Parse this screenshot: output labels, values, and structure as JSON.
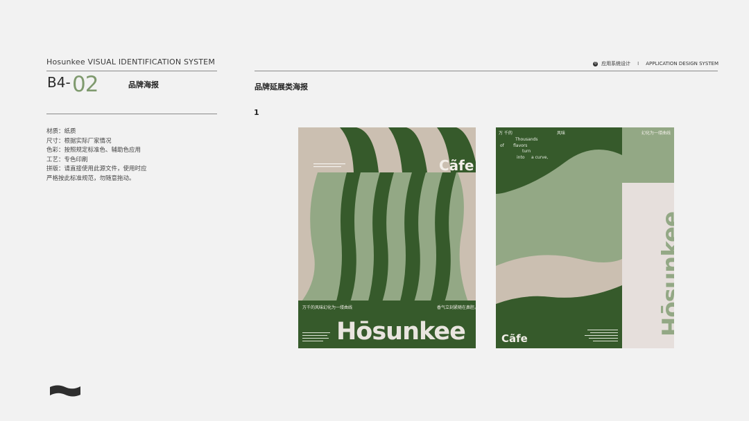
{
  "header": {
    "brand_line": "Hosunkee VISUAL IDENTIFICATION SYSTEM",
    "code_prefix": "B4-",
    "code_number": "02",
    "section_title": "品牌海报",
    "nav_number": "0",
    "nav_cn": "应用系统设计",
    "nav_divider": "I",
    "nav_en": "APPLICATION DESIGN SYSTEM"
  },
  "specs": [
    "材质：纸质",
    "尺寸：根据实际厂家情况",
    "色彩：按照规定标准色、辅助色应用",
    "工艺：专色印刷",
    "拼版：请直接使用此源文件，使用时应",
    "严格按此标准规范，勿随意拖动。"
  ],
  "main": {
    "subtitle": "品牌延展类海报",
    "item_number": "1"
  },
  "poster_left": {
    "cafe": "Cãfe",
    "brand": "Hōsunkee",
    "tagline_cn": "万千的风味幻化为一缕曲线",
    "tagline_right": "香气立刻紧随在鼻腔。"
  },
  "poster_right": {
    "cn_left": "万  千的",
    "cn_mid": "风味",
    "en_lines": [
      "Thousands",
      "of       flavors",
      "turn",
      "into     a curve,"
    ],
    "cafe": "Cãfe",
    "brand": "Hōsunkee",
    "corner_cn": "幻化为一缕曲线"
  },
  "colors": {
    "background": "#f2f2f2",
    "dark_green": "#365a2b",
    "sage": "#93a885",
    "beige": "#cbbfb1",
    "pale": "#e6dfdc",
    "accent_num": "#7f9a6e"
  }
}
